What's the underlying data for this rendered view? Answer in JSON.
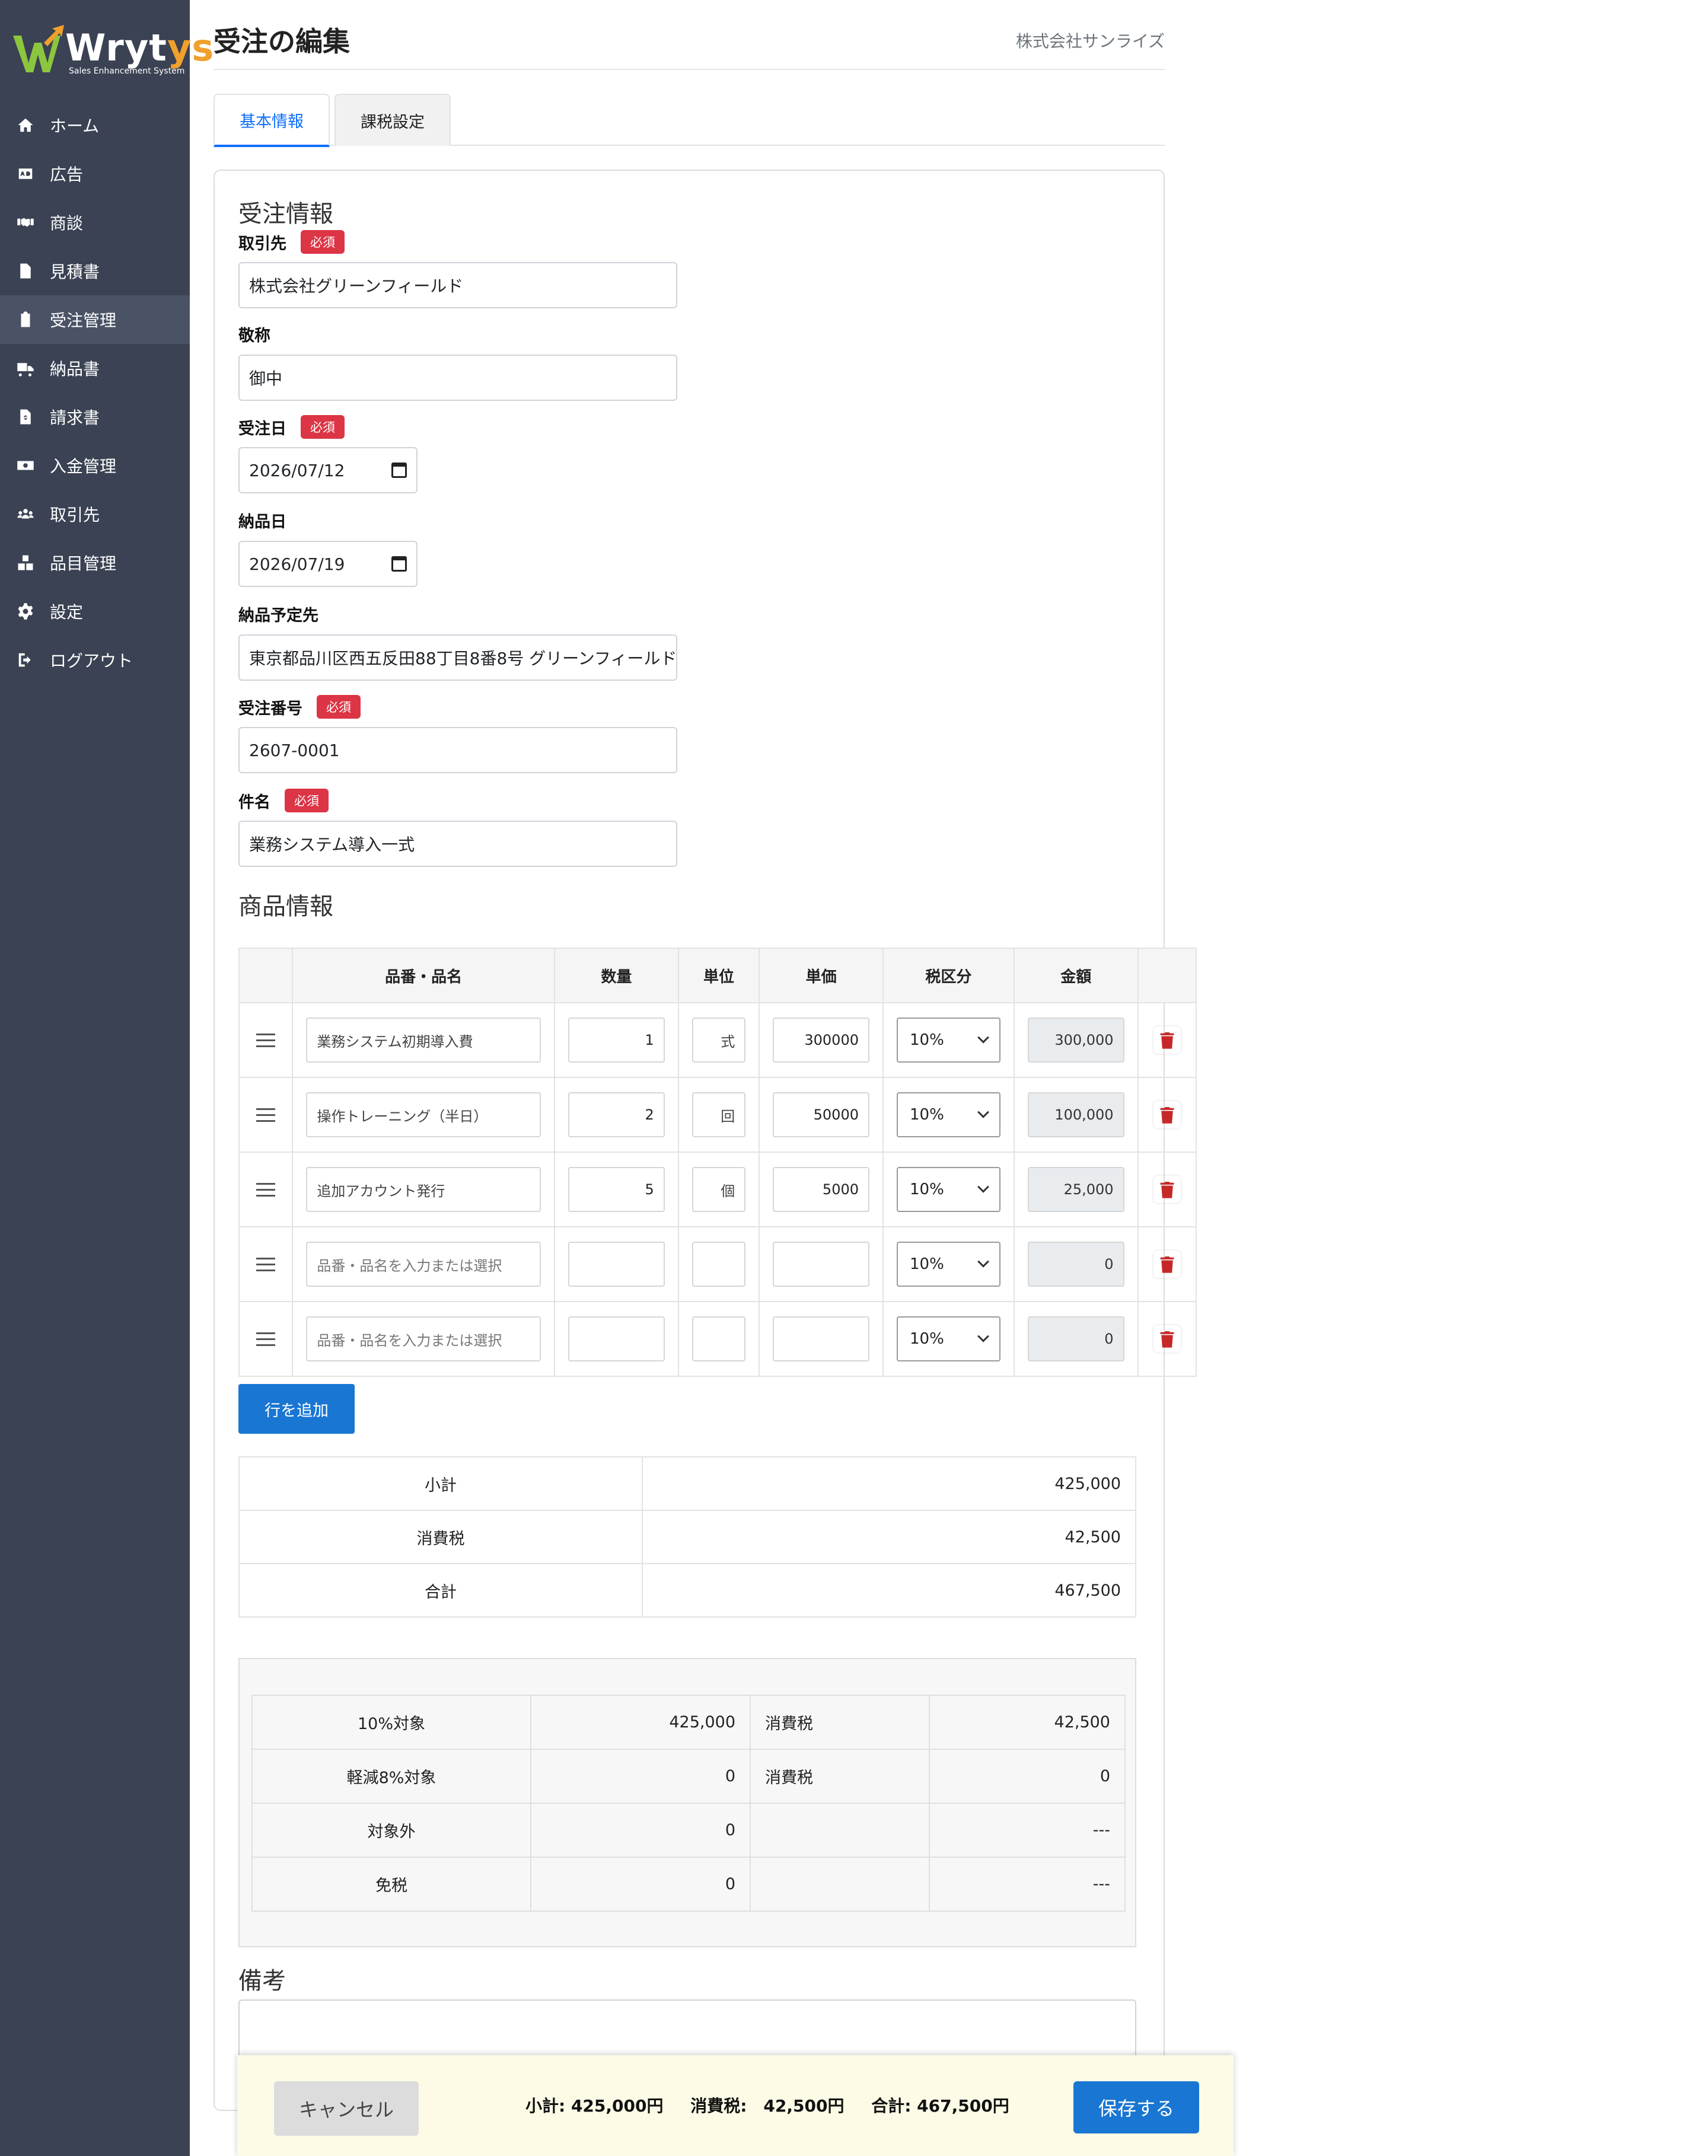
{
  "app": {
    "logo_text_main": "Wryt",
    "logo_text_accent": "ys",
    "logo_sub": "Sales Enhancement System"
  },
  "sidebar": {
    "items": [
      {
        "label": "ホーム",
        "icon": "home-icon"
      },
      {
        "label": "広告",
        "icon": "ad-icon"
      },
      {
        "label": "商談",
        "icon": "handshake-icon"
      },
      {
        "label": "見積書",
        "icon": "document-icon"
      },
      {
        "label": "受注管理",
        "icon": "clipboard-check-icon",
        "active": true
      },
      {
        "label": "納品書",
        "icon": "truck-icon"
      },
      {
        "label": "請求書",
        "icon": "invoice-icon"
      },
      {
        "label": "入金管理",
        "icon": "money-icon"
      },
      {
        "label": "取引先",
        "icon": "users-icon"
      },
      {
        "label": "品目管理",
        "icon": "boxes-icon"
      },
      {
        "label": "設定",
        "icon": "gear-icon"
      },
      {
        "label": "ログアウト",
        "icon": "logout-icon"
      }
    ]
  },
  "header": {
    "title": "受注の編集",
    "company": "株式会社サンライズ"
  },
  "tabs": [
    {
      "label": "基本情報",
      "active": true
    },
    {
      "label": "課税設定"
    }
  ],
  "order_info": {
    "section_title": "受注情報",
    "required_badge": "必須",
    "client_label": "取引先",
    "client_value": "株式会社グリーンフィールド",
    "honorific_label": "敬称",
    "honorific_value": "御中",
    "order_date_label": "受注日",
    "order_date_value": "2026/07/12",
    "delivery_date_label": "納品日",
    "delivery_date_value": "2026/07/19",
    "delivery_dest_label": "納品予定先",
    "delivery_dest_value": "東京都品川区西五反田88丁目8番8号 グリーンフィールド",
    "order_no_label": "受注番号",
    "order_no_value": "2607-0001",
    "subject_label": "件名",
    "subject_value": "業務システム導入一式"
  },
  "products": {
    "section_title": "商品情報",
    "headers": {
      "name": "品番・品名",
      "qty": "数量",
      "unit": "単位",
      "price": "単価",
      "tax": "税区分",
      "amount": "金額"
    },
    "rows": [
      {
        "name": "業務システム初期導入費",
        "qty": "1",
        "unit": "式",
        "price": "300000",
        "tax": "10%",
        "amount": "300,000"
      },
      {
        "name": "操作トレーニング（半日）",
        "qty": "2",
        "unit": "回",
        "price": "50000",
        "tax": "10%",
        "amount": "100,000"
      },
      {
        "name": "追加アカウント発行",
        "qty": "5",
        "unit": "個",
        "price": "5000",
        "tax": "10%",
        "amount": "25,000"
      },
      {
        "name": "",
        "qty": "",
        "unit": "",
        "price": "",
        "tax": "10%",
        "amount": "0"
      },
      {
        "name": "",
        "qty": "",
        "unit": "",
        "price": "",
        "tax": "10%",
        "amount": "0"
      }
    ],
    "name_placeholder": "品番・品名を入力または選択",
    "add_row_label": "行を追加"
  },
  "summary": [
    {
      "label": "小計",
      "value": "425,000"
    },
    {
      "label": "消費税",
      "value": "42,500"
    },
    {
      "label": "合計",
      "value": "467,500"
    }
  ],
  "tax_breakdown": [
    {
      "label": "10%対象",
      "base": "425,000",
      "tax_label": "消費税",
      "tax": "42,500"
    },
    {
      "label": "軽減8%対象",
      "base": "0",
      "tax_label": "消費税",
      "tax": "0"
    },
    {
      "label": "対象外",
      "base": "0",
      "tax_label": "",
      "tax": "---"
    },
    {
      "label": "免税",
      "base": "0",
      "tax_label": "",
      "tax": "---"
    }
  ],
  "remarks": {
    "section_title": "備考",
    "value": ""
  },
  "footer": {
    "cancel_label": "キャンセル",
    "subtotal_text": "小計: 425,000円",
    "tax_text": "消費税:　42,500円",
    "total_text": "合計: 467,500円",
    "save_label": "保存する"
  },
  "colors": {
    "sidebar_bg": "#3a4253",
    "primary": "#1976d2",
    "required": "#dc3545",
    "trash": "#c62828",
    "footer_bg": "#fdfbe6"
  }
}
